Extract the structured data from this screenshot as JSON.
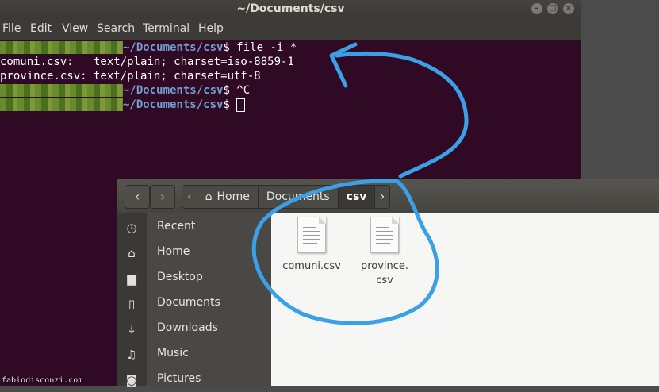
{
  "terminal": {
    "title": "~/Documents/csv",
    "menu": [
      "File",
      "Edit",
      "View",
      "Search",
      "Terminal",
      "Help"
    ],
    "lines": [
      {
        "path": "~/Documents/csv",
        "rest": "$ file -i *"
      },
      {
        "plain": "comuni.csv:   text/plain; charset=iso-8859-1"
      },
      {
        "plain": "province.csv: text/plain; charset=utf-8"
      },
      {
        "path": "~/Documents/csv",
        "rest": "$ ^C"
      },
      {
        "path": "~/Documents/csv",
        "rest": "$ "
      }
    ],
    "colors": {
      "background": "#300a24",
      "prompt_path": "#729fcf"
    }
  },
  "file_manager": {
    "breadcrumbs": [
      {
        "label": "Home",
        "icon": "home-icon"
      },
      {
        "label": "Documents"
      },
      {
        "label": "csv"
      }
    ],
    "sidebar": [
      {
        "label": "Recent",
        "icon": "clock-icon"
      },
      {
        "label": "Home",
        "icon": "home-icon"
      },
      {
        "label": "Desktop",
        "icon": "folder-icon"
      },
      {
        "label": "Documents",
        "icon": "document-icon"
      },
      {
        "label": "Downloads",
        "icon": "download-icon"
      },
      {
        "label": "Music",
        "icon": "music-note-icon"
      },
      {
        "label": "Pictures",
        "icon": "camera-icon"
      }
    ],
    "files": [
      {
        "name": "comuni.csv"
      },
      {
        "name": "province.\ncsv"
      }
    ]
  },
  "watermark": "fabiodisconzi.com",
  "annotation": {
    "color": "#3aa0e8"
  }
}
